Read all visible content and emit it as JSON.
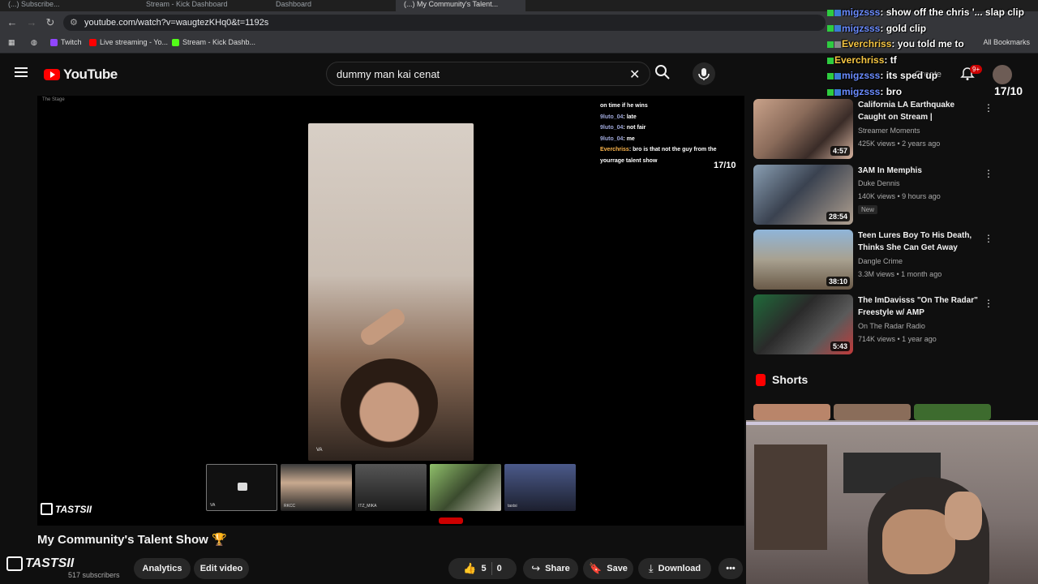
{
  "browser": {
    "tabs": [
      "(...) Subscribe...",
      "Stream - Kick Dashboard",
      "Dashboard",
      "(...) My Community's Talent..."
    ],
    "url": "youtube.com/watch?v=waugtezKHq0&t=1192s",
    "bookmarks": [
      "Twitch",
      "Live streaming - Yo...",
      "Stream - Kick Dashb..."
    ],
    "all_bookmarks": "All Bookmarks"
  },
  "header": {
    "logo_text": "YouTube",
    "search_query": "dummy man kai cenat",
    "create_label": "Create",
    "notif_badge": "9+"
  },
  "player": {
    "stage_label": "The Stage",
    "inner_chat": [
      {
        "user": "",
        "text": "on time if he wins"
      },
      {
        "user": "9luto_04",
        "text": "late"
      },
      {
        "user": "9luto_04",
        "text": "not fair"
      },
      {
        "user": "9luto_04",
        "text": "me"
      },
      {
        "user": "Everchriss",
        "text": "bro is that not the guy from the yourrage talent show"
      }
    ],
    "inner_score": "17/10",
    "main_cam_tag": "VA",
    "participants": [
      "VA",
      "RKCC",
      "ITZ_MIKA",
      "",
      "tastsi"
    ],
    "watermark": "TASTSII"
  },
  "video": {
    "title": "My Community's Talent Show 🏆",
    "channel_watermark": "TASTSII",
    "subscribers": "517 subscribers",
    "analytics": "Analytics",
    "edit_video": "Edit video",
    "likes": "5",
    "dislikes": "0",
    "share": "Share",
    "save": "Save",
    "download": "Download"
  },
  "sidebar": {
    "recs": [
      {
        "title": "California LA Earthquake Caught on Stream | Pokimane,...",
        "channel": "Streamer Moments",
        "meta": "425K views • 2 years ago",
        "duration": "4:57",
        "new": ""
      },
      {
        "title": "3AM In Memphis",
        "channel": "Duke Dennis",
        "meta": "140K views • 9 hours ago",
        "duration": "28:54",
        "new": "New"
      },
      {
        "title": "Teen Lures Boy To His Death, Thinks She Can Get Away With...",
        "channel": "Dangle Crime",
        "meta": "3.3M views • 1 month ago",
        "duration": "38:10",
        "new": ""
      },
      {
        "title": "The ImDavisss \"On The Radar\" Freestyle w/ AMP",
        "channel": "On The Radar Radio",
        "meta": "714K views • 1 year ago",
        "duration": "5:43",
        "new": ""
      }
    ],
    "shorts_label": "Shorts"
  },
  "overlay_chat": [
    {
      "user": "migzsss",
      "text": "show off the chris '... slap clip"
    },
    {
      "user": "migzsss",
      "text": "gold clip"
    },
    {
      "user": "Everchriss",
      "text": "you told me to"
    },
    {
      "user": "Everchriss",
      "text": "tf"
    },
    {
      "user": "migzsss",
      "text": "its sped up"
    },
    {
      "user": "migzsss",
      "text": "bro"
    }
  ],
  "overlay_score": "17/10",
  "colors": {
    "accent": "#ff0000",
    "chat_user_blue": "#6b8cff",
    "chat_user_gold": "#f5c542"
  }
}
